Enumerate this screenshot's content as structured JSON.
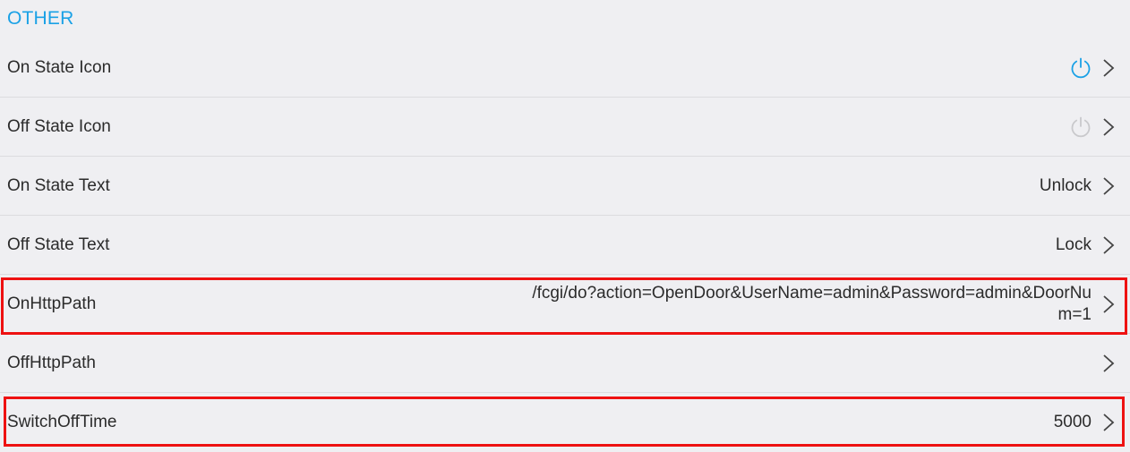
{
  "section": {
    "title": "OTHER"
  },
  "rows": {
    "on_state_icon": {
      "label": "On State Icon",
      "icon": "power-icon",
      "icon_color": "#1aa1e6"
    },
    "off_state_icon": {
      "label": "Off State Icon",
      "icon": "power-icon",
      "icon_color": "#c9c9cc"
    },
    "on_state_text": {
      "label": "On State Text",
      "value": "Unlock"
    },
    "off_state_text": {
      "label": "Off State Text",
      "value": "Lock"
    },
    "on_http_path": {
      "label": "OnHttpPath",
      "value": "/fcgi/do?action=OpenDoor&UserName=admin&Password=admin&DoorNum=1"
    },
    "off_http_path": {
      "label": "OffHttpPath",
      "value": ""
    },
    "switch_off_time": {
      "label": "SwitchOffTime",
      "value": "5000"
    }
  },
  "colors": {
    "accent": "#1aa1e6",
    "highlight": "#ee1111",
    "background": "#efeff2",
    "divider": "#dcdcdf"
  }
}
